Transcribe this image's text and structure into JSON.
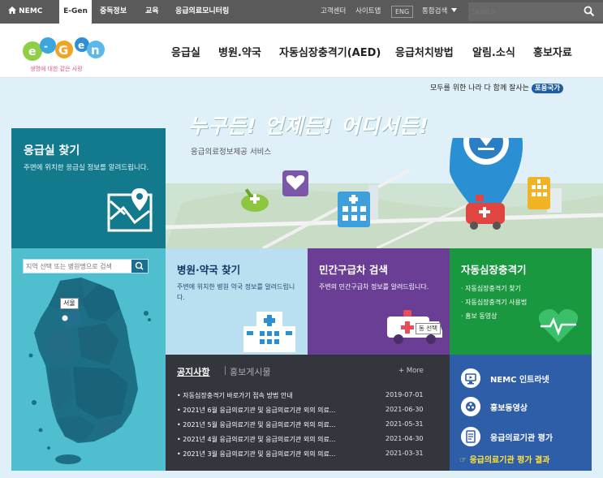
{
  "topbar": {
    "nemc": "NEMC",
    "egen": "E-Gen",
    "menu": [
      "중독정보",
      "교육",
      "응급의료모니터링"
    ],
    "customer_center": "고객센터",
    "sitemap": "사이트맵",
    "eng": "ENG",
    "unified_search": "통합검색",
    "search_placeholder": "Search",
    "icons": [
      "home-icon",
      "search-icon",
      "dropdown-arrow-icon"
    ]
  },
  "header": {
    "logo_text": "E-Gen",
    "logo_tagline": "생명에 대한 같은 사랑",
    "nav": [
      "응급실",
      "병원.약국",
      "자동심장충격기(AED)",
      "응급처치방법",
      "알림.소식",
      "홍보자료"
    ]
  },
  "hero": {
    "slogan": "모두를 위한 나라 다 함께 잘사는",
    "slogan_badge": "포용국가",
    "title": "누구든! 언제든! 어디서든!",
    "subtitle": "응급의료정보제공 서비스"
  },
  "er_finder": {
    "title": "응급실 찾기",
    "desc": "주변에 위치한 응급실 정보를 알려드립니다.",
    "search_placeholder": "지역 선택 또는 병원명으로 검색",
    "selected_region": "서울"
  },
  "tiles": {
    "hospital": {
      "title": "병원·약국 찾기",
      "desc": "주변에 위치한 병원 약국 정보를 알려드립니다."
    },
    "ambulance": {
      "title": "민간구급차 검색",
      "desc": "주변의 민간구급차 정보를 알려드립니다.",
      "tag": "동 선택"
    },
    "aed": {
      "title": "자동심장충격기",
      "items": [
        "자동심장충격기 찾기",
        "자동심장충격기 사용법",
        "홍보 동영상"
      ]
    }
  },
  "notices": {
    "tab_active": "공지사항",
    "tab_other": "홍보게시물",
    "more": "+ More",
    "items": [
      {
        "title": "자동심장충격기 바로가기 접속 방법 안내",
        "date": "2019-07-01"
      },
      {
        "title": "2021년 6월 응급의료기관 및 응급의료기관 외의 의료...",
        "date": "2021-06-30"
      },
      {
        "title": "2021년 5월 응급의료기관 및 응급의료기관 외의 의료...",
        "date": "2021-05-31"
      },
      {
        "title": "2021년 4월 응급의료기관 및 응급의료기관 외의 의료...",
        "date": "2021-04-30"
      },
      {
        "title": "2021년 3월 응급의료기관 및 응급의료기관 외의 의료...",
        "date": "2021-03-31"
      }
    ]
  },
  "quick_links": {
    "items": [
      {
        "label": "NEMC 인트라넷",
        "icon": "monitor-icon"
      },
      {
        "label": "홍보동영상",
        "icon": "film-reel-icon"
      },
      {
        "label": "응급의료기관 평가",
        "icon": "document-icon"
      }
    ],
    "result_link": "☞ 응급의료기관 평가 결과"
  },
  "colors": {
    "topbar": "#5a5a5a",
    "er_panel": "#127a8c",
    "map_bg": "#4fbfd0",
    "hospital_tile": "#b9dff1",
    "ambulance_tile": "#6b3e95",
    "aed_tile": "#19983f",
    "notice_bg": "#33363d",
    "quick_bg": "#2f5ea8",
    "highlight": "#ffe23a"
  }
}
